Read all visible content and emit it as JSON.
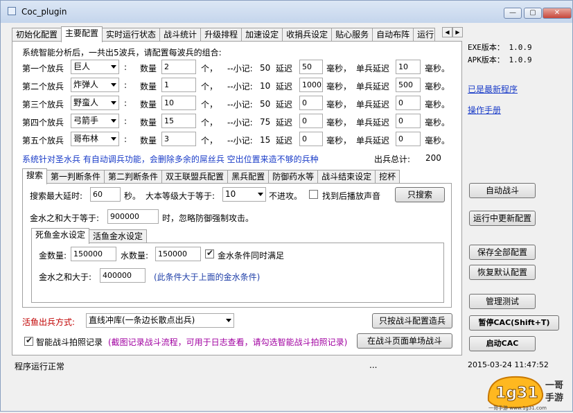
{
  "window": {
    "title": "Coc_plugin",
    "minimize": "—",
    "maximize": "▢",
    "close": "✕"
  },
  "main_tabs": [
    "初始化配置",
    "主要配置",
    "实时运行状态",
    "战斗统计",
    "升级排程",
    "加速设定",
    "收捐兵设定",
    "贴心服务",
    "自动布阵",
    "运行"
  ],
  "troops": {
    "intro": "系统智能分析后，一共出5波兵，请配置每波兵的组合:",
    "rows": [
      {
        "label": "第一个放兵",
        "troop": "巨人",
        "qty": "2",
        "note_label": "--小记:",
        "note_val": "50",
        "delay": "50",
        "unit_delay": "10"
      },
      {
        "label": "第二个放兵",
        "troop": "炸弹人",
        "qty": "1",
        "note_label": "--小记:",
        "note_val": "10",
        "delay": "1000",
        "unit_delay": "500"
      },
      {
        "label": "第三个放兵",
        "troop": "野蛮人",
        "qty": "10",
        "note_label": "--小记:",
        "note_val": "50",
        "delay": "0",
        "unit_delay": "0"
      },
      {
        "label": "第四个放兵",
        "troop": "弓箭手",
        "qty": "15",
        "note_label": "--小记:",
        "note_val": "75",
        "delay": "0",
        "unit_delay": "0"
      },
      {
        "label": "第五个放兵",
        "troop": "哥布林",
        "qty": "3",
        "note_label": "--小记:",
        "note_val": "15",
        "delay": "0",
        "unit_delay": "0"
      }
    ],
    "colon": ":",
    "qty_label": "数量",
    "ge": "个，",
    "delay_label": "延迟",
    "ms_comma": "毫秒，",
    "unit_delay_label": "单兵延迟",
    "ms_end": "毫秒。",
    "notice": "系统针对圣水兵 有自动调兵功能，会删除多余的屌丝兵 空出位置来造不够的兵种",
    "total_label": "出兵总计:",
    "total_value": "200"
  },
  "sub_tabs": [
    "搜索",
    "第一判断条件",
    "第二判断条件",
    "双王联盟兵配置",
    "黑兵配置",
    "防御药水等",
    "战斗结束设定",
    "挖杯"
  ],
  "search": {
    "max_delay_label": "搜索最大延时:",
    "max_delay_value": "60",
    "sec": "秒。",
    "base_level_label": "大本等级大于等于:",
    "base_level_value": "10",
    "no_attack": "不进攻。",
    "sound_label": "找到后播放声音",
    "only_search_btn": "只搜索",
    "gold_water_label": "金水之和大于等于:",
    "gold_water_value": "900000",
    "ignore_defense": "时，忽略防御强制攻击。"
  },
  "gold_tabs": [
    "死鱼金水设定",
    "活鱼金水设定"
  ],
  "dead_fish": {
    "gold_label": "金数量:",
    "gold_value": "150000",
    "water_label": "水数量:",
    "water_value": "150000",
    "both_label": "金水条件同时满足",
    "sum_label": "金水之和大于:",
    "sum_value": "400000",
    "sum_note": "(此条件大于上面的金水条件)"
  },
  "live_fish": {
    "mode_label": "活鱼出兵方式:",
    "mode_value": "直线冲库(一条边长散点出兵)",
    "by_config_btn": "只按战斗配置造兵",
    "photo_label": "智能战斗拍照记录",
    "photo_note": "(截图记录战斗流程，可用于日志查看，请勾选智能战斗拍照记录)",
    "single_battle_btn": "在战斗页面单场战斗"
  },
  "status": {
    "text": "程序运行正常",
    "dots": "...",
    "datetime": "2015-03-24 11:47:52"
  },
  "side": {
    "exe_version": "EXE版本： 1.0.9",
    "apk_version": "APK版本： 1.0.9",
    "latest_link": "已是最新程序",
    "manual_link": "操作手册",
    "btn_auto_battle": "自动战斗",
    "btn_update_running": "运行中更新配置",
    "btn_save_all": "保存全部配置",
    "btn_restore": "恢复默认配置",
    "btn_admin_test": "管理测试",
    "btn_pause": "暂停CAC(Shift+T)",
    "btn_start": "启动CAC"
  },
  "watermark": {
    "brand": "1g31",
    "tag1": "一哥",
    "tag2": "手游",
    "url": "一哥手游 www.1g31.com"
  },
  "colors": {
    "blue": "#1a3cc8",
    "red": "#c00000",
    "purple": "#a000a0"
  }
}
